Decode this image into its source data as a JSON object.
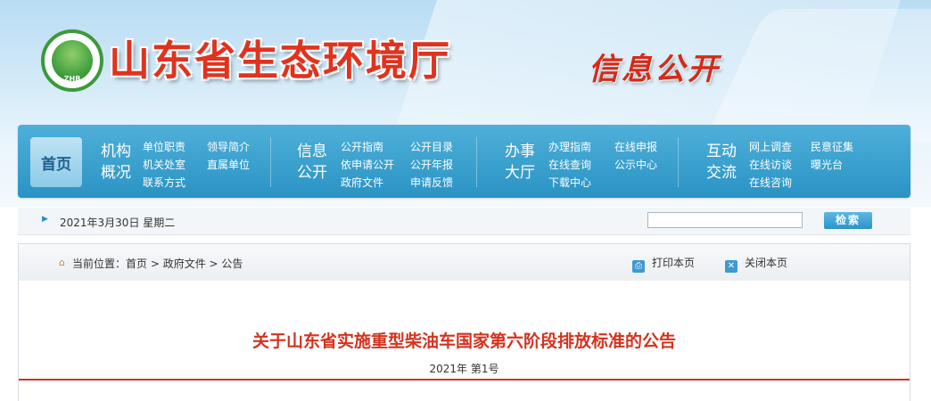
{
  "header": {
    "logo_text": "ZHB",
    "site_title": "山东省生态环境厅",
    "section_title": "信息公开"
  },
  "nav": {
    "home_label": "首页",
    "groups": [
      {
        "category": [
          "机构",
          "概况"
        ],
        "links": [
          "单位职责",
          "领导简介",
          "机关处室",
          "直属单位",
          "联系方式"
        ]
      },
      {
        "category": [
          "信息",
          "公开"
        ],
        "links": [
          "公开指南",
          "公开目录",
          "依申请公开",
          "公开年报",
          "政府文件",
          "申请反馈"
        ]
      },
      {
        "category": [
          "办事",
          "大厅"
        ],
        "links": [
          "办理指南",
          "在线申报",
          "在线查询",
          "公示中心",
          "下载中心"
        ]
      },
      {
        "category": [
          "互动",
          "交流"
        ],
        "links": [
          "网上调查",
          "民意征集",
          "在线访谈",
          "曝光台",
          "在线咨询"
        ]
      }
    ]
  },
  "datebar": {
    "date": "2021年3月30日 星期二",
    "search_placeholder": "",
    "search_button": "检索"
  },
  "breadcrumb": {
    "prefix": "当前位置：",
    "items": [
      "首页",
      "政府文件",
      "公告"
    ],
    "separator": " > "
  },
  "tools": {
    "print": "打印本页",
    "close": "关闭本页"
  },
  "article": {
    "title": "关于山东省实施重型柴油车国家第六阶段排放标准的公告",
    "doc_number": "2021年 第1号"
  },
  "colors": {
    "accent_red": "#d5321e",
    "nav_blue": "#2a93c4",
    "logo_green": "#3b9a3a"
  },
  "icons": {
    "logo": "zhb-logo-icon",
    "date": "arrow-right-icon",
    "home": "home-icon",
    "print": "print-icon",
    "close": "close-icon"
  }
}
